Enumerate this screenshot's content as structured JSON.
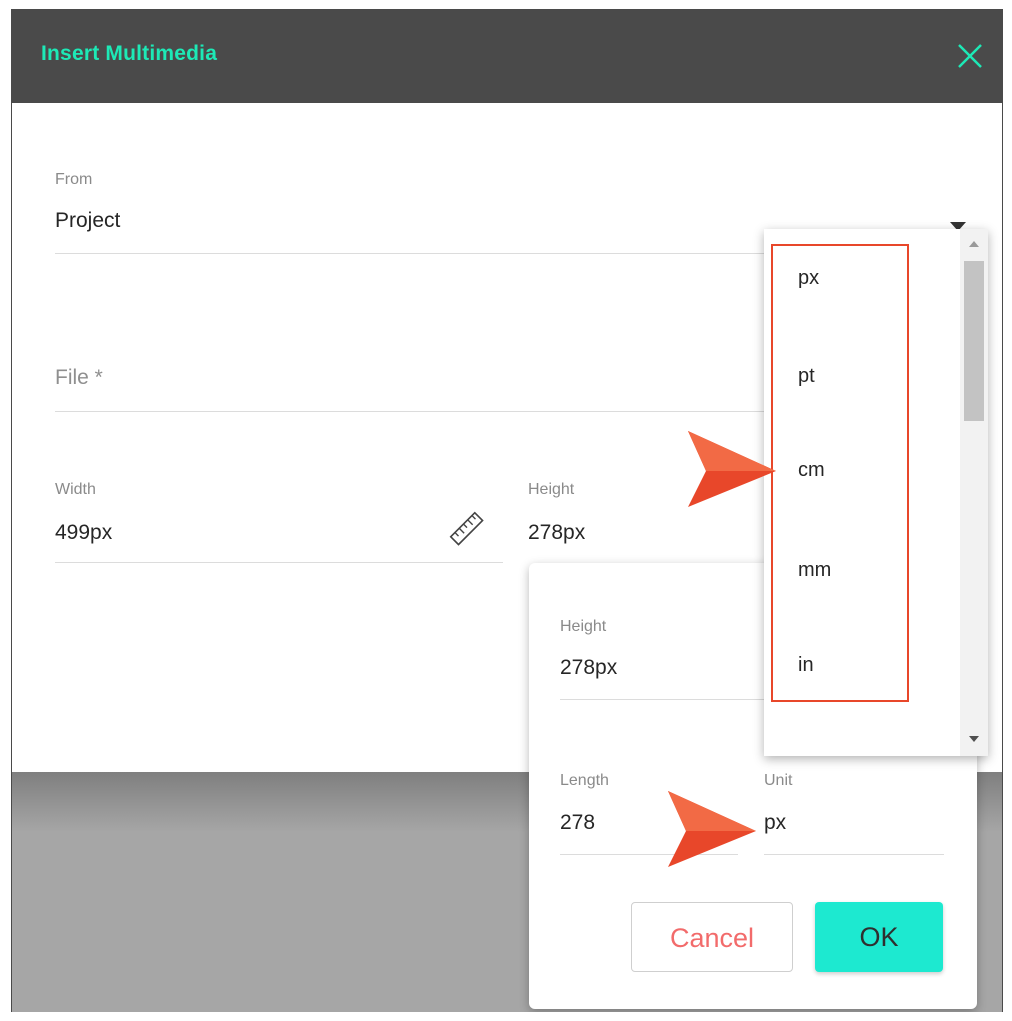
{
  "dialog": {
    "title": "Insert Multimedia",
    "close_icon": "close-icon",
    "from": {
      "label": "From",
      "value": "Project"
    },
    "file": {
      "placeholder": "File *"
    },
    "width": {
      "label": "Width",
      "value": "499px",
      "icon": "ruler-icon"
    },
    "height": {
      "label": "Height",
      "value": "278px"
    }
  },
  "unit_popover": {
    "height": {
      "label": "Height",
      "value": "278px"
    },
    "length": {
      "label": "Length",
      "value": "278"
    },
    "unit": {
      "label": "Unit",
      "value": "px"
    },
    "cancel_label": "Cancel",
    "ok_label": "OK"
  },
  "unit_dropdown": {
    "options": [
      "px",
      "pt",
      "cm",
      "mm",
      "in"
    ]
  },
  "colors": {
    "accent": "#1de9b6",
    "titlebar": "#4a4a4a",
    "ok_button": "#1de9d0",
    "cancel_text": "#f26b6b",
    "annotation": "#e8472a"
  }
}
